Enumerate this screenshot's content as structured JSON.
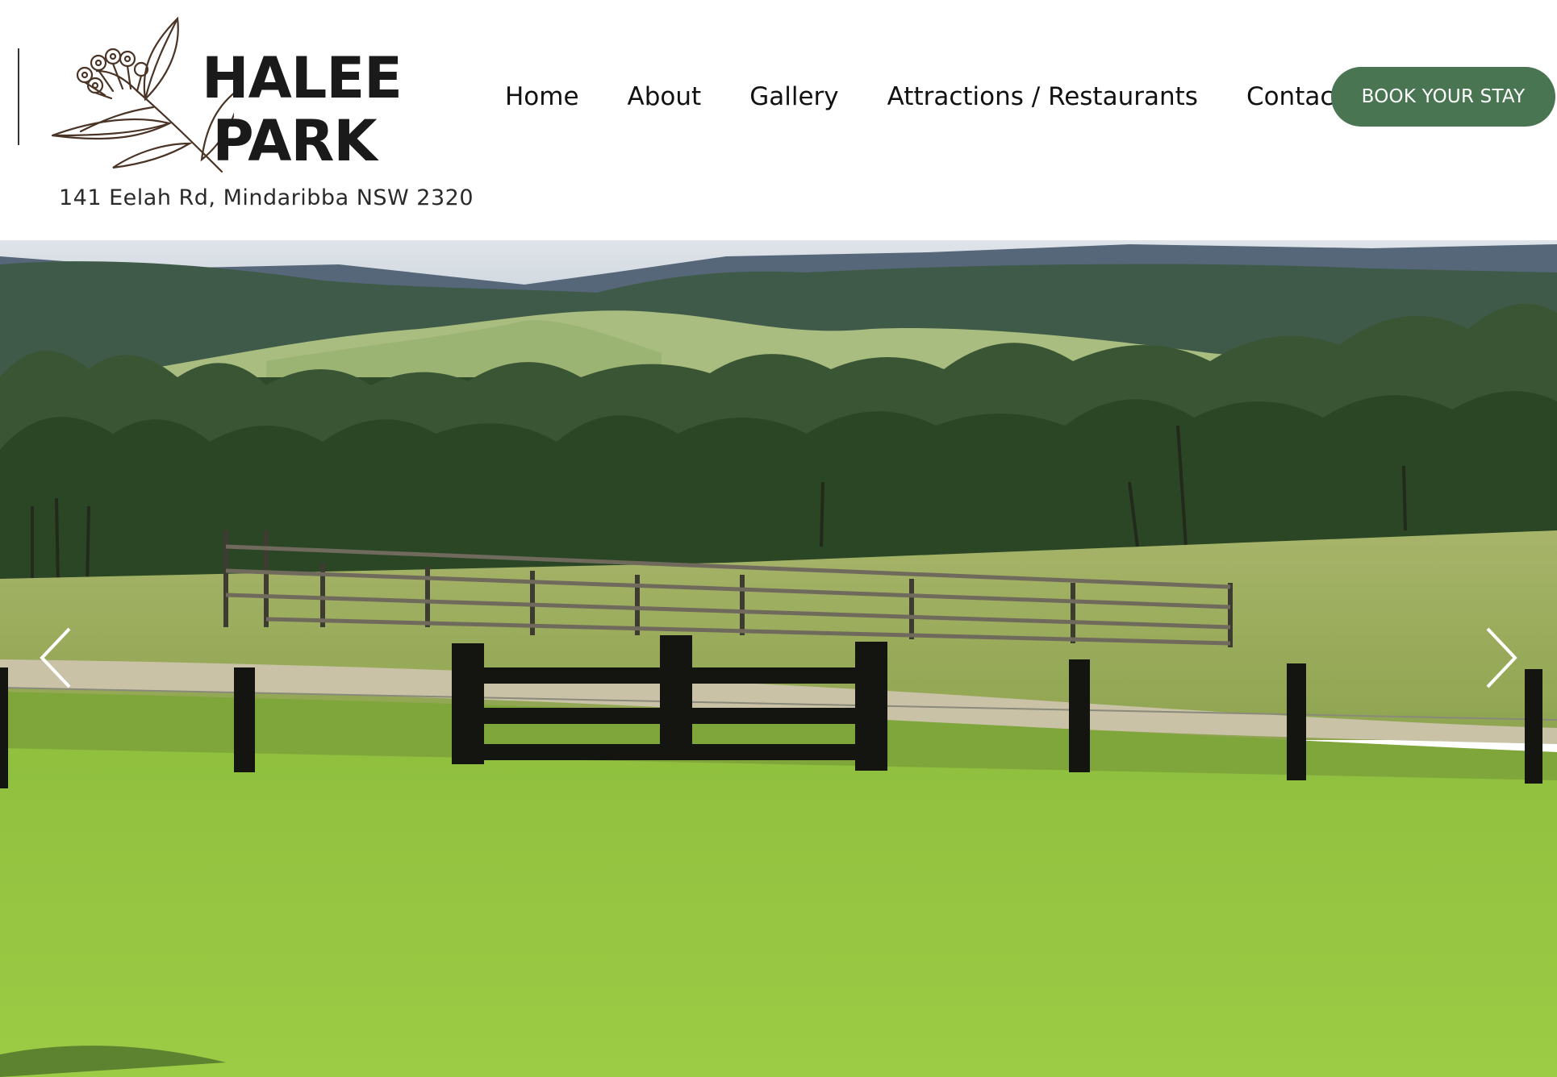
{
  "brand": {
    "name_line1": "HALEE",
    "name_line2": "PARK",
    "logo_icon": "eucalyptus-branch-icon",
    "address": "141 Eelah Rd, Mindaribba NSW 2320"
  },
  "nav": {
    "items": [
      {
        "label": "Home"
      },
      {
        "label": "About"
      },
      {
        "label": "Gallery"
      },
      {
        "label": "Attractions / Restaurants"
      },
      {
        "label": "Contact"
      }
    ],
    "cta_label": "BOOK YOUR STAY"
  },
  "hero": {
    "slideshow_prev_icon": "chevron-left-icon",
    "slideshow_next_icon": "chevron-right-icon"
  },
  "colors": {
    "cta_background": "#4a7552",
    "cta_text": "#ffffff",
    "text": "#111111"
  }
}
